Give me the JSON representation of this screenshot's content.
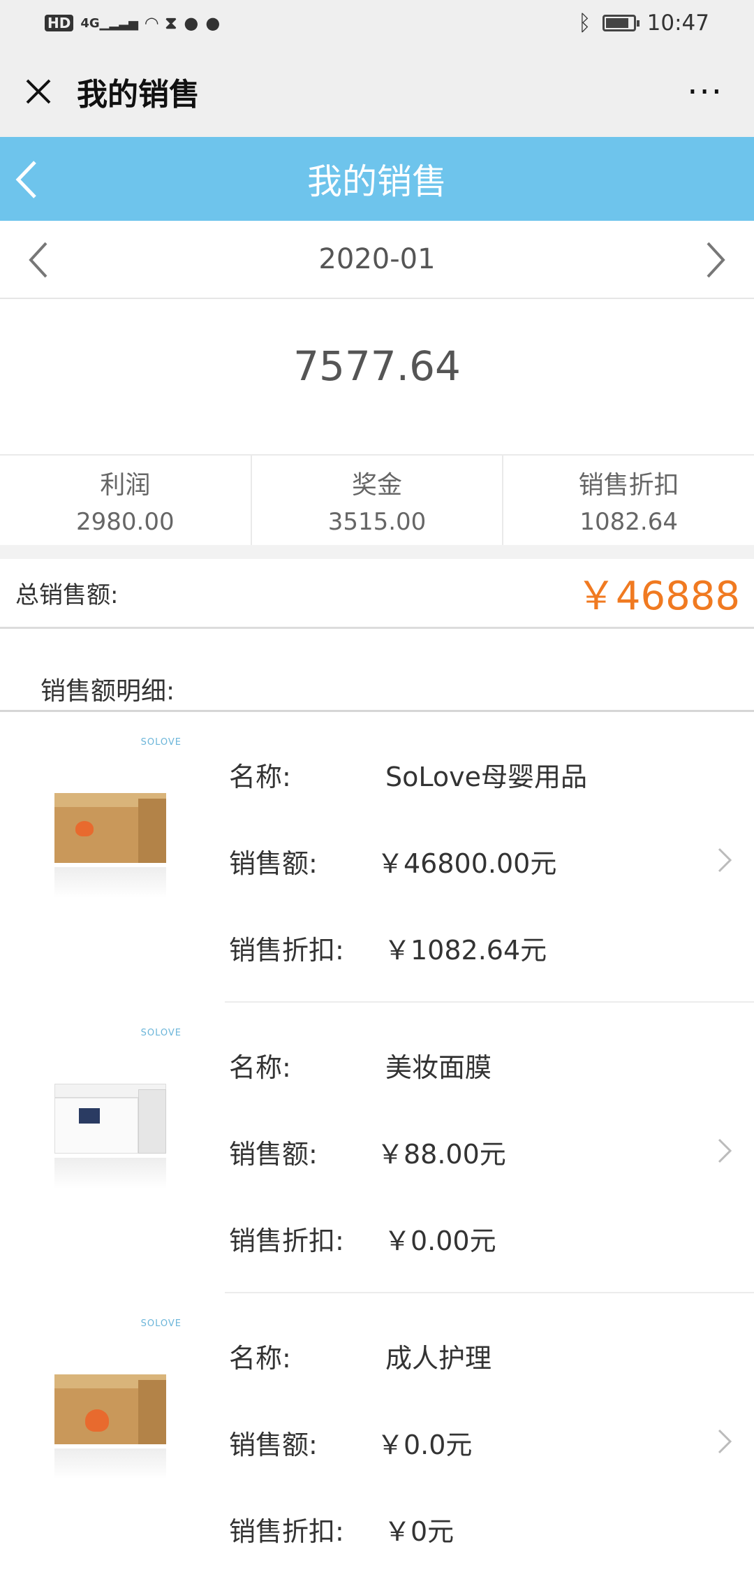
{
  "status_bar": {
    "left_icons": [
      "hd-icon",
      "4g-signal-icon",
      "wifi-icon",
      "hourglass-icon",
      "wechat-icon",
      "wechat-icon"
    ],
    "hd": "HD",
    "net": "4G",
    "time": "10:47",
    "battery_level": 0.85
  },
  "wechat_bar": {
    "title": "我的销售",
    "more": "···"
  },
  "app_header": {
    "title": "我的销售"
  },
  "month": {
    "label": "2020-01"
  },
  "summary": {
    "total": "7577.64"
  },
  "stats": [
    {
      "label": "利润",
      "value": "2980.00"
    },
    {
      "label": "奖金",
      "value": "3515.00"
    },
    {
      "label": "销售折扣",
      "value": "1082.64"
    }
  ],
  "sales_total": {
    "label": "总销售额:",
    "value": "￥46888",
    "color": "#f07a21"
  },
  "detail": {
    "title": "销售额明细:"
  },
  "row_labels": {
    "name": "名称:",
    "amount": "销售额:",
    "discount": "销售折扣:"
  },
  "items": [
    {
      "brand": "SOLOVE",
      "name": "SoLove母婴用品",
      "amount": "￥46800.00元",
      "discount": "￥1082.64元",
      "box": "kraft"
    },
    {
      "brand": "SOLOVE",
      "name": "美妆面膜",
      "amount": "￥88.00元",
      "discount": "￥0.00元",
      "box": "white"
    },
    {
      "brand": "SOLOVE",
      "name": "成人护理",
      "amount": "￥0.0元",
      "discount": "￥0元",
      "box": "kraft"
    }
  ],
  "colors": {
    "header_blue": "#6ec4ec",
    "accent_orange": "#f07a21"
  }
}
